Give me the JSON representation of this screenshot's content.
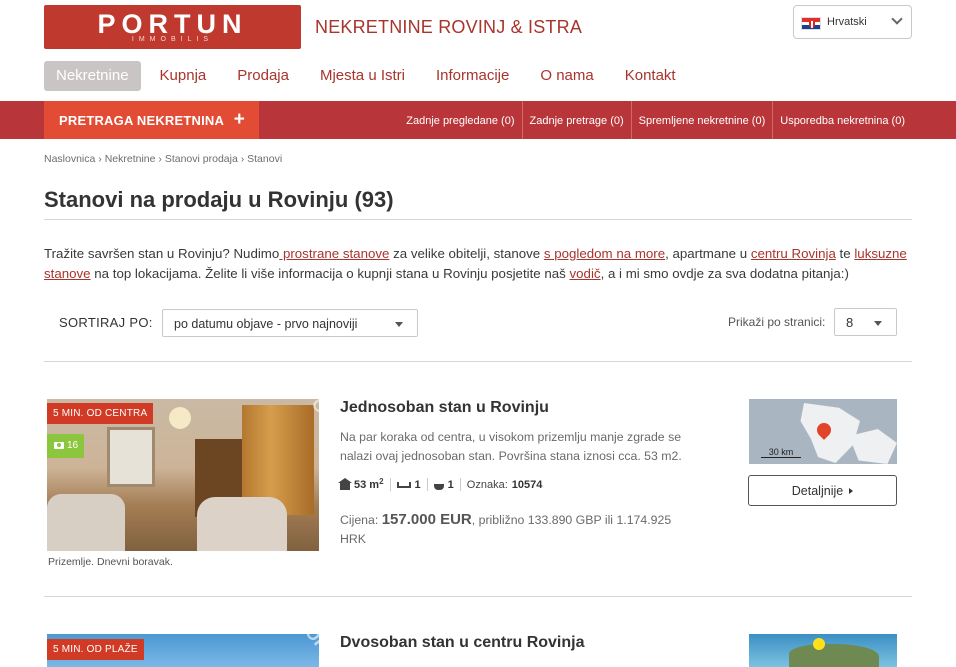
{
  "brand": {
    "logo_text": "PORTUN",
    "logo_sub": "IMMOBILIS",
    "tagline": "NEKRETNINE ROVINJ & ISTRA"
  },
  "language": {
    "selected": "Hrvatski",
    "flag_icon": "croatia-flag-icon"
  },
  "nav": {
    "items": [
      {
        "label": "Nekretnine",
        "active": true
      },
      {
        "label": "Kupnja"
      },
      {
        "label": "Prodaja"
      },
      {
        "label": "Mjesta u Istri"
      },
      {
        "label": "Informacije"
      },
      {
        "label": "O nama"
      },
      {
        "label": "Kontakt"
      }
    ]
  },
  "toolbar": {
    "search_label": "PRETRAGA NEKRETNINA",
    "search_icon": "+",
    "links": [
      {
        "label": "Zadnje pregledane (0)"
      },
      {
        "label": "Zadnje pretrage (0)"
      },
      {
        "label": "Spremljene nekretnine (0)"
      },
      {
        "label": "Usporedba nekretnina (0)"
      }
    ]
  },
  "breadcrumb": [
    "Naslovnica",
    "Nekretnine",
    "Stanovi prodaja",
    "Stanovi"
  ],
  "breadcrumb_sep": "›",
  "page": {
    "title": "Stanovi na prodaju u Rovinju (93)",
    "intro": {
      "t1": "Tražite savršen stan u Rovinju? Nudimo",
      "l1": " prostrane stanove",
      "t2": " za velike obitelji, stanove ",
      "l2": "s pogledom na more",
      "t3": ", apartmane u ",
      "l3": "centru Rovinja",
      "t4": " te ",
      "l4": "luksuzne stanove",
      "t5": " na top lokacijama. Želite li više informacija o kupnji stana u Rovinju posjetite naš ",
      "l5": "vodič",
      "t6": ", a i mi smo ovdje za sva dodatna pitanja:)"
    }
  },
  "sort": {
    "label": "SORTIRAJ PO:",
    "selected": "po datumu objave - prvo najnoviji",
    "per_page_label": "Prikaži po stranici:",
    "per_page_value": "8"
  },
  "listings": [
    {
      "badge": "5 MIN. OD CENTRA",
      "photo_count": "16",
      "caption": "Prizemlje. Dnevni boravak.",
      "title": "Jednosoban stan u Rovinju",
      "description": "Na par koraka od centra, u visokom prizemlju manje zgrade se nalazi ovaj jednosoban stan. Površina stana iznosi cca. 53 m2.",
      "area": "53 m",
      "area_sup": "2",
      "bedrooms": "1",
      "bathrooms": "1",
      "code_label": "Oznaka:",
      "code": "10574",
      "price_label": "Cijena:",
      "price": "157.000 EUR",
      "price_conv": ", približno 133.890 GBP ili 1.174.925 HRK",
      "map_scale": "30 km",
      "details_label": "Detaljnije",
      "watermark": "PORTUN"
    },
    {
      "badge": "5 MIN. OD PLAŽE",
      "title": "Dvosoban stan u centru Rovinja",
      "watermark": "PORTUN"
    }
  ]
}
